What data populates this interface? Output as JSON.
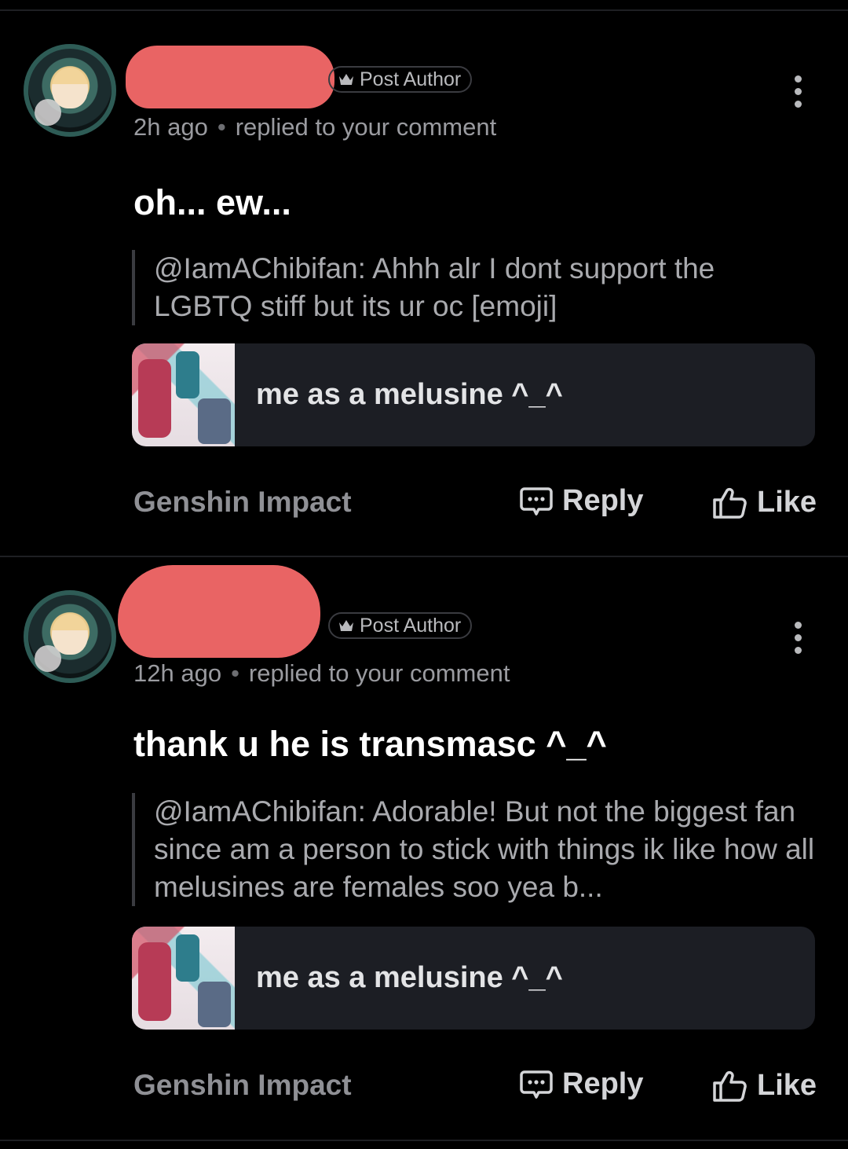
{
  "comments": [
    {
      "badge": "Post Author",
      "time": "2h ago",
      "action_text": "replied to your comment",
      "separator": "•",
      "body": "oh... ew...",
      "quote": "@IamAChibifan: Ahhh alr I dont support the LGBTQ stiff but its ur oc [emoji]",
      "card_title": "me as a melusine ^_^",
      "topic": "Genshin Impact",
      "reply_label": "Reply",
      "like_label": "Like"
    },
    {
      "badge": "Post Author",
      "time": "12h ago",
      "action_text": "replied to your comment",
      "separator": "•",
      "body": "thank u he is transmasc ^_^",
      "quote": "@IamAChibifan: Adorable! But not the biggest fan since am a person to stick with things ik like how all melusines are females soo yea b...",
      "card_title": "me as a melusine ^_^",
      "topic": "Genshin Impact",
      "reply_label": "Reply",
      "like_label": "Like"
    }
  ],
  "icons": {
    "badge": "crown-icon",
    "more": "more-vertical-icon",
    "reply": "comment-icon",
    "like": "thumbs-up-icon"
  },
  "colors": {
    "background": "#000000",
    "redaction": "#e96464",
    "card": "#1c1e24",
    "text_primary": "#ffffff",
    "text_muted": "#9a9ba0"
  }
}
